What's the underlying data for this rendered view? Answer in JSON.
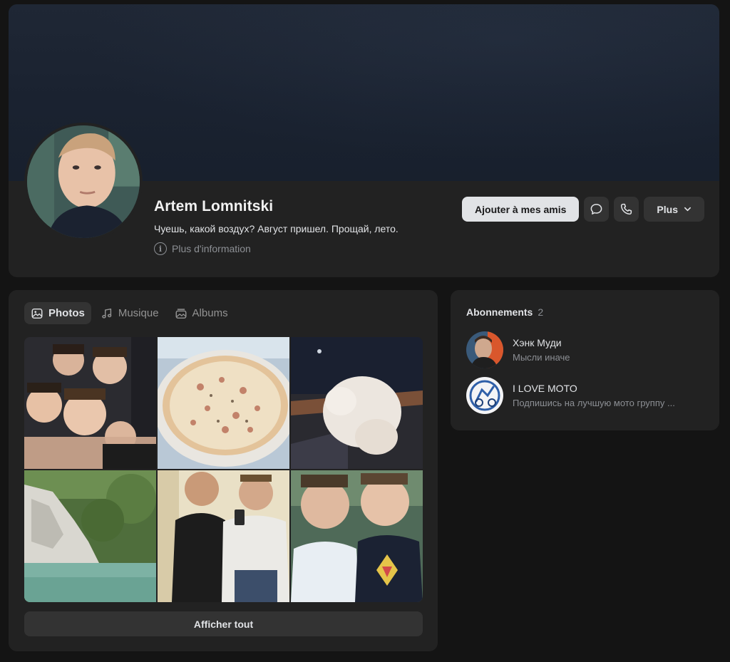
{
  "profile": {
    "name": "Artem Lomnitski",
    "status": "Чуешь, какой воздух? Август пришел. Прощай, лето.",
    "more_info": "Plus d'information",
    "actions": {
      "add_friend": "Ajouter à mes amis",
      "more": "Plus"
    },
    "icons": {
      "message": "message-icon",
      "call": "phone-icon",
      "more_chevron": "chevron-down-icon",
      "info": "info-icon"
    }
  },
  "media": {
    "tabs": [
      {
        "label": "Photos",
        "icon": "photo-icon",
        "active": true
      },
      {
        "label": "Musique",
        "icon": "music-note-icon",
        "active": false
      },
      {
        "label": "Albums",
        "icon": "album-icon",
        "active": false
      }
    ],
    "photos": [
      {
        "description": "group-selfie"
      },
      {
        "description": "pizza"
      },
      {
        "description": "white-cat"
      },
      {
        "description": "river-rock"
      },
      {
        "description": "two-boys-selfie"
      },
      {
        "description": "two-boys-outdoor"
      }
    ],
    "show_all": "Afficher tout"
  },
  "subscriptions": {
    "title": "Abonnements",
    "count": "2",
    "items": [
      {
        "name": "Хэнк Муди",
        "description": "Мысли иначе"
      },
      {
        "name": "I LOVE MOTO",
        "description": "Подпишись на лучшую мото группу ..."
      }
    ]
  },
  "colors": {
    "page_bg": "#141414",
    "card_bg": "#222222",
    "button_bg": "#333333",
    "primary_button_bg": "#e1e3e6",
    "text_primary": "#e1e3e6",
    "text_secondary": "#8c8f94"
  }
}
